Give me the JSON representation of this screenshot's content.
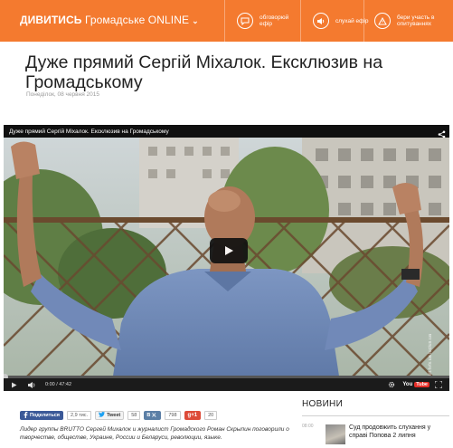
{
  "topbar": {
    "brand_bold": "ДИВИТИСЬ",
    "brand_light": "Громадське ONLINE",
    "chevron": "⌄",
    "color": "#f47a2f",
    "nav": [
      {
        "icon": "chat-bubble-icon",
        "label": "обговорюй ефір"
      },
      {
        "icon": "speaker-icon",
        "label": "слухай ефір"
      },
      {
        "icon": "warning-triangle-icon",
        "label": "бери участь в опитуваннях"
      }
    ]
  },
  "article": {
    "title": "Дуже прямий Сергій Міхалок. Ексклюзив на Громадському",
    "date": "Понеділок, 08 червня 2015"
  },
  "video": {
    "title": "Дуже прямий Сергій Міхалок. Ексклюзив на Громадському",
    "time": "0:00 / 47:42",
    "watermark": "kit.tv/s.ua lucius.ua",
    "progress": 0,
    "icons": [
      "share-icon",
      "play-icon",
      "volume-icon",
      "settings-gear-icon",
      "fullscreen-icon",
      "youtube-logo"
    ],
    "youtube": {
      "you": "You",
      "tube": "Tube"
    }
  },
  "social": {
    "facebook_label": "Поделиться",
    "facebook_count": "2,9 тис.",
    "twitter_label": "Tweet",
    "twitter_count": "58",
    "vk_label": "В",
    "vk_count": "798",
    "gplus_label": "g+1",
    "gplus_count": "20"
  },
  "lead": "Лидер группы BRUTTO Сергей Михалок и журналист Громадского Роман Скрыпин поговорили о творчестве, обществе, Украине, России и Беларуси, революции, языке.",
  "news": {
    "heading": "НОВИНИ",
    "items": [
      {
        "time": "08:00",
        "text": "Суд продовжить слухання у справі Попова 2 липня"
      }
    ]
  }
}
